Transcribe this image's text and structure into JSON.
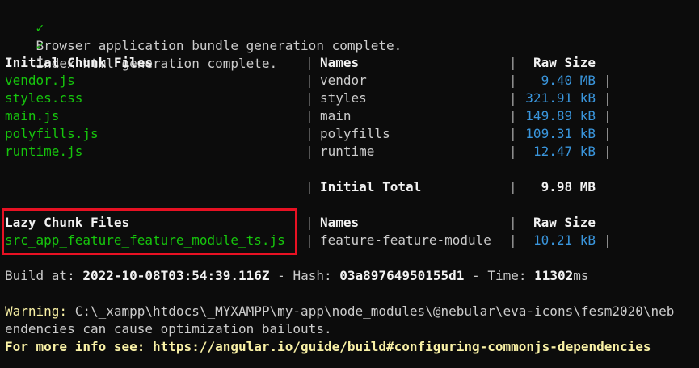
{
  "status": [
    {
      "mark": "✓",
      "text": "Browser application bundle generation complete."
    },
    {
      "mark": "✓",
      "text": "Index html generation complete."
    }
  ],
  "separator": "|",
  "initial": {
    "headers": {
      "file": "Initial Chunk Files",
      "names": "Names",
      "size": "Raw Size"
    },
    "rows": [
      {
        "file": "vendor.js",
        "name": "vendor",
        "size": "9.40 MB"
      },
      {
        "file": "styles.css",
        "name": "styles",
        "size": "321.91 kB"
      },
      {
        "file": "main.js",
        "name": "main",
        "size": "149.89 kB"
      },
      {
        "file": "polyfills.js",
        "name": "polyfills",
        "size": "109.31 kB"
      },
      {
        "file": "runtime.js",
        "name": "runtime",
        "size": "12.47 kB"
      }
    ],
    "total": {
      "label": "Initial Total",
      "size": "9.98 MB"
    }
  },
  "lazy": {
    "headers": {
      "file": "Lazy Chunk Files",
      "names": "Names",
      "size": "Raw Size"
    },
    "rows": [
      {
        "file": "src_app_feature_feature_module_ts.js",
        "name": "feature-feature-module",
        "size": "10.21 kB"
      }
    ]
  },
  "build": {
    "at_label": "Build at:",
    "at_value": "2022-10-08T03:54:39.116Z",
    "dash1": "-",
    "hash_label": "Hash:",
    "hash_value": "03a89764950155d1",
    "dash2": "-",
    "time_label": "Time:",
    "time_value": "11302",
    "time_unit": "ms"
  },
  "warning": {
    "label": "Warning:",
    "text": "C:\\_xampp\\htdocs\\_MYXAMPP\\my-app\\node_modules\\@nebular\\eva-icons\\fesm2020\\neb",
    "line2": "endencies can cause optimization bailouts.",
    "more_info": "For more info see: https://angular.io/guide/build#configuring-commonjs-dependencies"
  },
  "colors": {
    "background": "#0c0c0c",
    "text": "#cccccc",
    "green": "#16c60c",
    "cyan": "#3a96dd",
    "yellow": "#f9f1a5",
    "highlight_border": "#e81123"
  }
}
